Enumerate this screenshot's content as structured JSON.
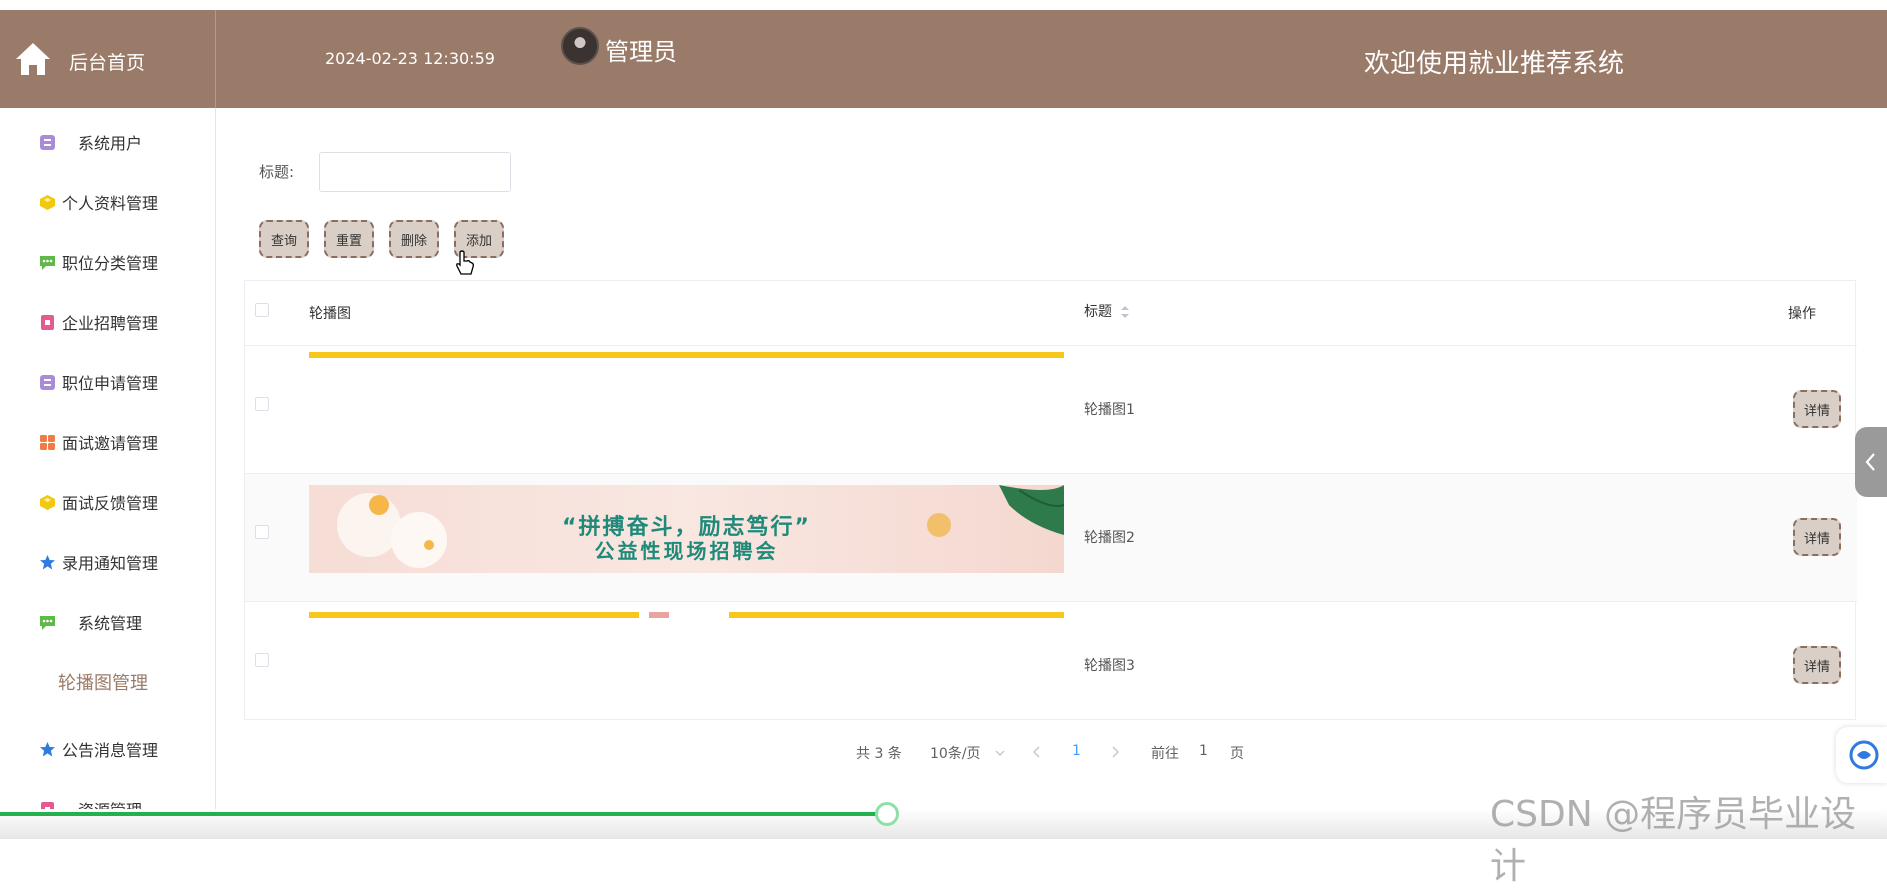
{
  "header": {
    "home_label": "后台首页",
    "datetime": "2024-02-23 12:30:59",
    "admin": "管理员",
    "welcome": "欢迎使用就业推荐系统",
    "bg_color": "#9a7b69"
  },
  "sidebar": {
    "items": [
      {
        "label": "系统用户",
        "icon": "archive-icon",
        "color": "#a98bd6"
      },
      {
        "label": "个人资料管理",
        "icon": "cube-icon",
        "color": "#f2c811"
      },
      {
        "label": "职位分类管理",
        "icon": "chat-icon",
        "color": "#5fb84a"
      },
      {
        "label": "企业招聘管理",
        "icon": "bag-icon",
        "color": "#e45b8f"
      },
      {
        "label": "职位申请管理",
        "icon": "archive-icon",
        "color": "#a98bd6"
      },
      {
        "label": "面试邀请管理",
        "icon": "grid-icon",
        "color": "#ef7b45"
      },
      {
        "label": "面试反馈管理",
        "icon": "cube-icon",
        "color": "#f2c811"
      },
      {
        "label": "录用通知管理",
        "icon": "star-icon",
        "color": "#2f7be0"
      },
      {
        "label": "系统管理",
        "icon": "chat-icon",
        "color": "#5fb84a"
      },
      {
        "label": "轮播图管理",
        "icon": "",
        "color": ""
      },
      {
        "label": "公告消息管理",
        "icon": "star-icon",
        "color": "#2f7be0"
      },
      {
        "label": "资源管理",
        "icon": "bag-icon",
        "color": "#e45b8f"
      }
    ]
  },
  "search": {
    "title_label": "标题:",
    "title_value": "",
    "title_placeholder": ""
  },
  "toolbar": {
    "query_label": "查询",
    "reset_label": "重置",
    "delete_label": "删除",
    "add_label": "添加"
  },
  "table": {
    "columns": {
      "image": "轮播图",
      "title": "标题",
      "actions": "操作"
    },
    "rows": [
      {
        "title": "轮播图1",
        "detail": "详情"
      },
      {
        "title": "轮播图2",
        "detail": "详情",
        "banner_line1": "“拼搏奋斗，励志笃行”",
        "banner_line2": "公益性现场招聘会"
      },
      {
        "title": "轮播图3",
        "detail": "详情"
      }
    ]
  },
  "pagination": {
    "total": "共 3 条",
    "page_size": "10条/页",
    "current": "1",
    "goto_label": "前往",
    "goto_value": "1",
    "page_suffix": "页"
  },
  "watermark": "CSDN @程序员毕业设计",
  "video_progress": 0.47
}
